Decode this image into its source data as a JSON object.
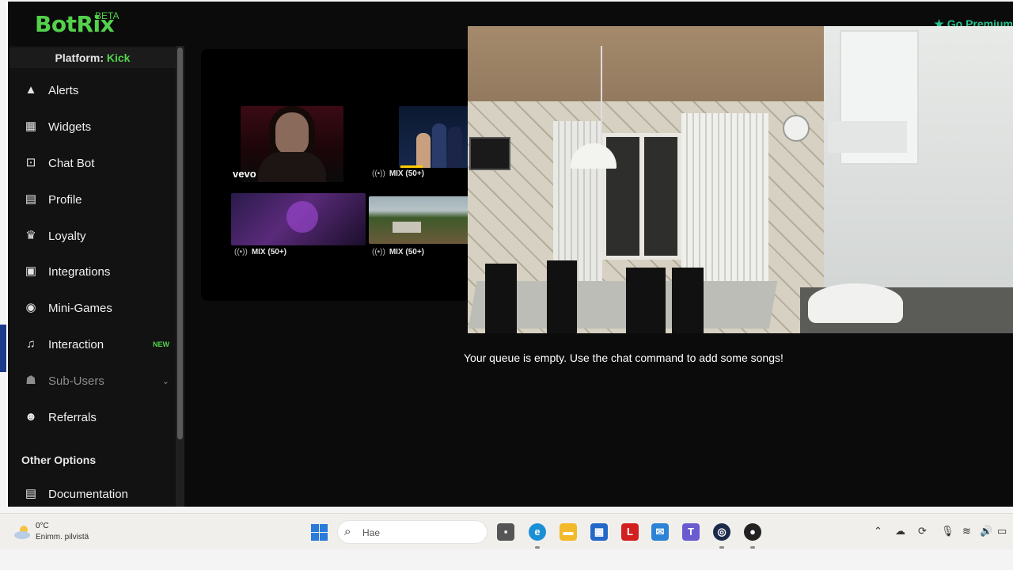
{
  "header": {
    "logo": "BotRix",
    "logo_badge": "BETA",
    "premium_label": "Go Premium"
  },
  "sidebar": {
    "platform_prefix": "Platform:",
    "platform_name": "Kick",
    "items": [
      {
        "label": "Alerts",
        "icon": "warning-icon"
      },
      {
        "label": "Widgets",
        "icon": "widgets-icon"
      },
      {
        "label": "Chat Bot",
        "icon": "robot-icon"
      },
      {
        "label": "Profile",
        "icon": "id-card-icon"
      },
      {
        "label": "Loyalty",
        "icon": "trophy-icon"
      },
      {
        "label": "Integrations",
        "icon": "integrations-icon"
      },
      {
        "label": "Mini-Games",
        "icon": "gamepad-icon"
      },
      {
        "label": "Interaction",
        "icon": "music-icon",
        "badge": "NEW"
      },
      {
        "label": "Sub-Users",
        "icon": "users-icon"
      },
      {
        "label": "Referrals",
        "icon": "user-group-icon"
      }
    ],
    "section_title": "Other Options",
    "documentation": "Documentation"
  },
  "player": {
    "suggestions": [
      {
        "badge": "vevo"
      },
      {
        "label": "MIX (50+)"
      },
      {
        "label": "MIX (50+)"
      },
      {
        "label": "MIX (50+)"
      }
    ]
  },
  "queue": {
    "empty_message": "Your queue is empty. Use the chat command to add some songs!"
  },
  "taskbar": {
    "weather_temp": "0°C",
    "weather_desc": "Enimm. pilvistä",
    "search_placeholder": "Hae",
    "accent": "#2b7bd8"
  }
}
